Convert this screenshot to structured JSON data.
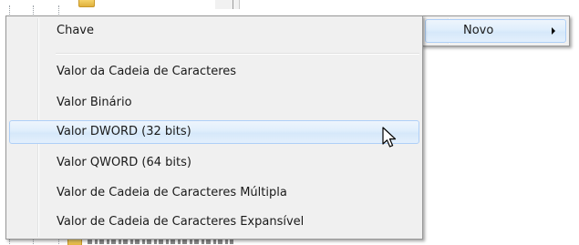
{
  "context_menu": {
    "item_label": "Novo"
  },
  "submenu": {
    "items": [
      {
        "label": "Chave"
      },
      {
        "label": "Valor da Cadeia de Caracteres"
      },
      {
        "label": "Valor Binário"
      },
      {
        "label": "Valor DWORD (32 bits)"
      },
      {
        "label": "Valor QWORD (64 bits)"
      },
      {
        "label": "Valor de Cadeia de Caracteres Múltipla"
      },
      {
        "label": "Valor de Cadeia de Caracteres Expansível"
      }
    ],
    "highlighted_item": "Valor DWORD (32 bits)"
  },
  "icons": {
    "submenu_arrow": "chevron-right-icon",
    "cursor": "mouse-pointer-icon"
  },
  "colors": {
    "menu_background": "#f0f0f0",
    "menu_border": "#979797",
    "highlight_border": "#aecff7",
    "highlight_fill": "#dfeefc"
  }
}
